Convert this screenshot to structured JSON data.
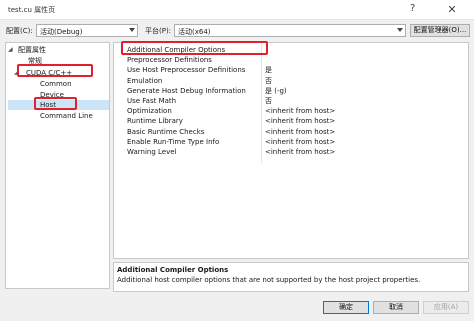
{
  "window": {
    "title": "test.cu 属性页",
    "help_glyph": "?",
    "close_glyph": "✕"
  },
  "config_bar": {
    "config_label": "配置(C):",
    "config_value": "活动(Debug)",
    "platform_label": "平台(P):",
    "platform_value": "活动(x64)",
    "config_manager_label": "配置管理器(O)..."
  },
  "tree": {
    "items": [
      {
        "label": "配置属性",
        "toggle": "◢"
      },
      {
        "label": "常规"
      },
      {
        "label": "CUDA C/C++",
        "toggle": "◢"
      },
      {
        "label": "Common"
      },
      {
        "label": "Device"
      },
      {
        "label": "Host",
        "selected": true
      },
      {
        "label": "Command Line"
      }
    ]
  },
  "properties": [
    {
      "name": "Additional Compiler Options",
      "value": ""
    },
    {
      "name": "Preprocessor Definitions",
      "value": ""
    },
    {
      "name": "Use Host Preprocessor Definitions",
      "value": "是"
    },
    {
      "name": "Emulation",
      "value": "否"
    },
    {
      "name": "Generate Host Debug Information",
      "value": "是 (-g)"
    },
    {
      "name": "Use Fast Math",
      "value": "否"
    },
    {
      "name": "Optimization",
      "value": "<inherit from host>"
    },
    {
      "name": "Runtime Library",
      "value": "<inherit from host>"
    },
    {
      "name": "Basic Runtime Checks",
      "value": "<inherit from host>"
    },
    {
      "name": "Enable Run-Time Type Info",
      "value": "<inherit from host>"
    },
    {
      "name": "Warning Level",
      "value": "<inherit from host>"
    }
  ],
  "description": {
    "title": "Additional Compiler Options",
    "text": "Additional host compiler options that are not supported by the host project properties."
  },
  "buttons": {
    "ok": "确定",
    "cancel": "取消",
    "apply": "应用(A)"
  },
  "colors": {
    "annotation_red": "#e0212b",
    "selection_blue": "#cce4f7"
  }
}
